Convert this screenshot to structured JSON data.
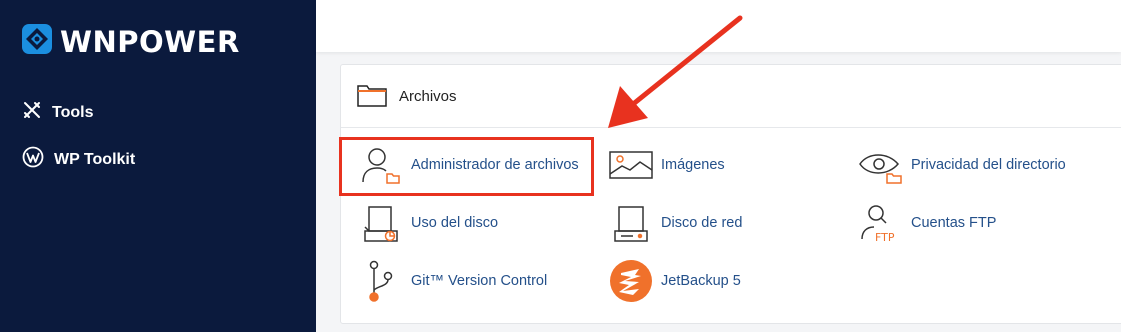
{
  "brand": {
    "name": "WNPOWER",
    "icon": "wnpower-logo-icon"
  },
  "sidebar": {
    "items": [
      {
        "label": "Tools",
        "icon": "tools-icon"
      },
      {
        "label": "WP Toolkit",
        "icon": "wordpress-icon"
      }
    ]
  },
  "section": {
    "title": "Archivos",
    "icon": "folder-icon"
  },
  "items": [
    {
      "label": "Administrador de archivos",
      "icon": "file-manager-icon"
    },
    {
      "label": "Imágenes",
      "icon": "images-icon"
    },
    {
      "label": "Privacidad del directorio",
      "icon": "directory-privacy-icon"
    },
    {
      "label": "Uso del disco",
      "icon": "disk-usage-icon"
    },
    {
      "label": "Disco de red",
      "icon": "network-disk-icon"
    },
    {
      "label": "Cuentas FTP",
      "icon": "ftp-accounts-icon"
    },
    {
      "label": "Git™ Version Control",
      "icon": "git-icon"
    },
    {
      "label": "JetBackup 5",
      "icon": "jetbackup-icon"
    }
  ],
  "ftp_badge": "FTP",
  "colors": {
    "sidebar": "#0b1a3d",
    "link": "#24508a",
    "accent": "#f0712b",
    "highlight": "#e8321f"
  }
}
